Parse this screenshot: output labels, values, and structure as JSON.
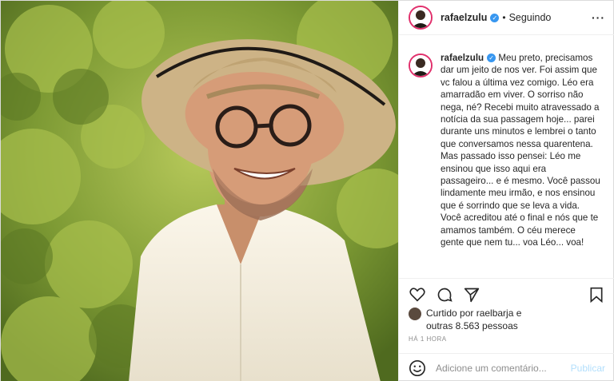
{
  "post": {
    "image_alt": "Foto de um homem sorrindo com chapéu de palha e óculos",
    "photo_bg": "#6f8f2e"
  },
  "header": {
    "username": "rafaelzulu",
    "separator": "•",
    "follow_label": "Seguindo",
    "more_icon": "more-horizontal-icon",
    "more_glyph": "···"
  },
  "caption": {
    "username": "rafaelzulu",
    "text": "Meu preto, precisamos dar um jeito de nos ver. Foi assim que vc falou a última vez comigo. Léo era amarradão em viver. O sorriso não nega, né? Recebi muito atravessado a notícia da sua passagem hoje... parei durante uns minutos e lembrei o tanto que conversamos nessa quarentena. Mas passado isso pensei: Léo me ensinou que isso aqui era passageiro... e é mesmo. Você passou lindamente meu irmão, e nos ensinou que é sorrindo que se leva a vida. Você acreditou até o final e nós que te amamos também. O céu merece gente que nem tu... voa Léo... voa!"
  },
  "actions": {
    "like_icon": "heart-icon",
    "comment_icon": "comment-icon",
    "share_icon": "share-icon",
    "save_icon": "bookmark-icon"
  },
  "likes": {
    "text": "Curtido por raelbarja e outras 8.563 pessoas"
  },
  "timestamp": "HÁ 1 HORA",
  "comment_box": {
    "emoji_icon": "smile-icon",
    "placeholder": "Adicione um comentário...",
    "publish_label": "Publicar"
  },
  "colors": {
    "accent": "#3897f0",
    "publish_disabled": "#b2dffc",
    "story_ring": "#e1306c"
  }
}
